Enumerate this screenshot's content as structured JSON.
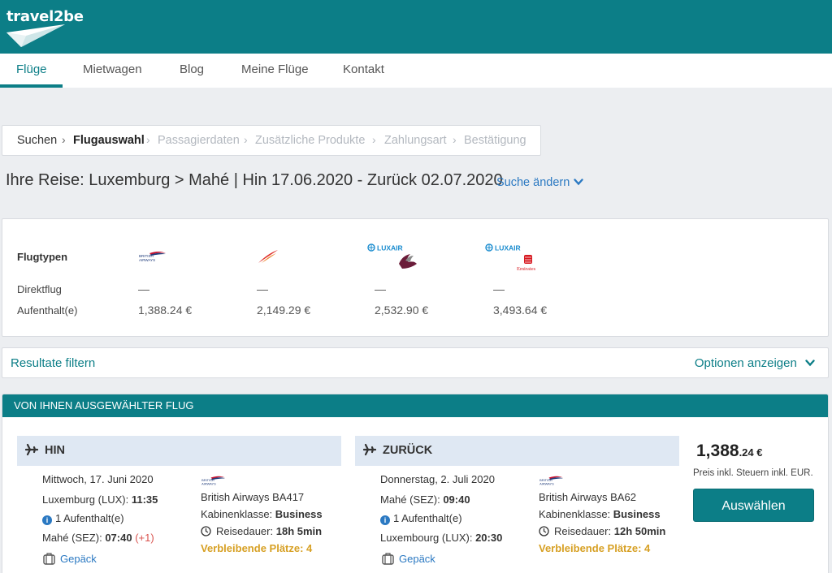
{
  "app": {
    "logo_text": "travel2be"
  },
  "nav": {
    "items": [
      {
        "label": "Flüge",
        "active": true
      },
      {
        "label": "Mietwagen"
      },
      {
        "label": "Blog"
      },
      {
        "label": "Meine Flüge"
      },
      {
        "label": "Kontakt"
      }
    ]
  },
  "breadcrumb": {
    "steps": [
      {
        "label": "Suchen",
        "state": "done"
      },
      {
        "label": "Flugauswahl",
        "state": "current"
      },
      {
        "label": "Passagierdaten",
        "state": "future"
      },
      {
        "label": "Zusätzliche Produkte",
        "state": "future"
      },
      {
        "label": "Zahlungsart",
        "state": "future"
      },
      {
        "label": "Bestätigung",
        "state": "future"
      }
    ]
  },
  "trip": {
    "title": "Ihre Reise: Luxemburg > Mahé | Hin 17.06.2020 - Zurück 02.07.2020",
    "change_label": "Suche ändern"
  },
  "matrix": {
    "row_labels": {
      "types": "Flugtypen",
      "direct": "Direktflug",
      "stops": "Aufenthalt(e)"
    },
    "columns": [
      {
        "airlines": [
          "british-airways-logo"
        ],
        "direct": "—",
        "stops_price": "1,388.24 €"
      },
      {
        "airlines": [
          "air-seychelles-logo"
        ],
        "direct": "—",
        "stops_price": "2,149.29 €"
      },
      {
        "airlines": [
          "luxair-logo",
          "qatar-airways-logo"
        ],
        "luxair_text": "LUXAIR",
        "direct": "—",
        "stops_price": "2,532.90 €"
      },
      {
        "airlines": [
          "luxair-logo",
          "emirates-logo"
        ],
        "luxair_text": "LUXAIR",
        "emirates_text": "Emirates",
        "direct": "—",
        "stops_price": "3,493.64 €"
      }
    ]
  },
  "filter": {
    "label": "Resultate filtern",
    "options_label": "Optionen anzeigen"
  },
  "selected": {
    "header": "VON IHNEN AUSGEWÄHLTER FLUG",
    "outbound": {
      "title": "HIN",
      "date": "Mittwoch, 17. Juni 2020",
      "dep_place": "Luxemburg (LUX):",
      "dep_time": "11:35",
      "stops": "1 Aufenthalt(e)",
      "arr_place": "Mahé (SEZ):",
      "arr_time": "07:40",
      "day_offset": "(+1)",
      "baggage": "Gepäck",
      "airline_flight": "British Airways BA417",
      "cabin_label": "Kabinenklasse:",
      "cabin_value": "Business",
      "duration_label": "Reisedauer:",
      "duration_value": "18h 5min",
      "seats": "Verbleibende Plätze: 4"
    },
    "return": {
      "title": "ZURÜCK",
      "date": "Donnerstag, 2. Juli 2020",
      "dep_place": "Mahé (SEZ):",
      "dep_time": "09:40",
      "stops": "1 Aufenthalt(e)",
      "arr_place": "Luxembourg (LUX):",
      "arr_time": "20:30",
      "baggage": "Gepäck",
      "airline_flight": "British Airways BA62",
      "cabin_label": "Kabinenklasse:",
      "cabin_value": "Business",
      "duration_label": "Reisedauer:",
      "duration_value": "12h 50min",
      "seats": "Verbleibende Plätze: 4"
    },
    "price_int": "1,388",
    "price_dec": ".24 €",
    "price_note": "Preis inkl. Steuern inkl. EUR.",
    "select_label": "Auswählen"
  },
  "colors": {
    "brand": "#0c7e87",
    "link": "#2b79c2",
    "warning": "#d7a024",
    "leg_bg": "#dfe8f3"
  }
}
